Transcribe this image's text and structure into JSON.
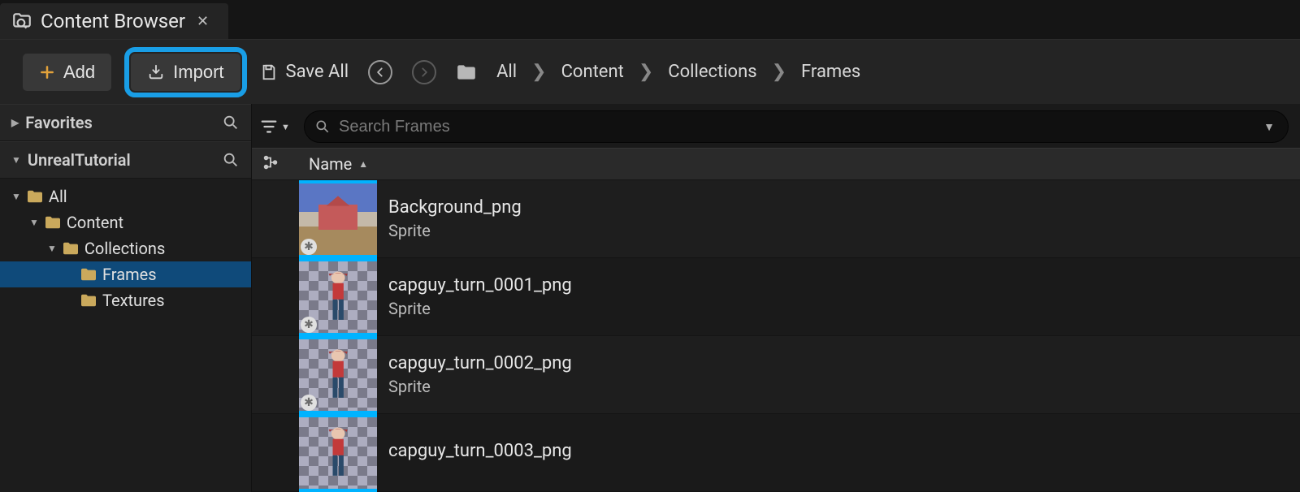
{
  "tab": {
    "title": "Content Browser"
  },
  "toolbar": {
    "add_label": "Add",
    "import_label": "Import",
    "save_all_label": "Save All"
  },
  "breadcrumbs": [
    "All",
    "Content",
    "Collections",
    "Frames"
  ],
  "sidebar": {
    "favorites_label": "Favorites",
    "project_label": "UnrealTutorial",
    "tree": [
      {
        "label": "All",
        "depth": 0,
        "expanded": true,
        "selected": false
      },
      {
        "label": "Content",
        "depth": 1,
        "expanded": true,
        "selected": false
      },
      {
        "label": "Collections",
        "depth": 2,
        "expanded": true,
        "selected": false
      },
      {
        "label": "Frames",
        "depth": 3,
        "expanded": false,
        "selected": true
      },
      {
        "label": "Textures",
        "depth": 3,
        "expanded": false,
        "selected": false
      }
    ]
  },
  "search": {
    "placeholder": "Search Frames"
  },
  "columns": {
    "name_header": "Name"
  },
  "assets": [
    {
      "name": "Background_png",
      "type": "Sprite",
      "thumb": "scene"
    },
    {
      "name": "capguy_turn_0001_png",
      "type": "Sprite",
      "thumb": "checker"
    },
    {
      "name": "capguy_turn_0002_png",
      "type": "Sprite",
      "thumb": "checker"
    },
    {
      "name": "capguy_turn_0003_png",
      "type": "",
      "thumb": "checker"
    }
  ]
}
